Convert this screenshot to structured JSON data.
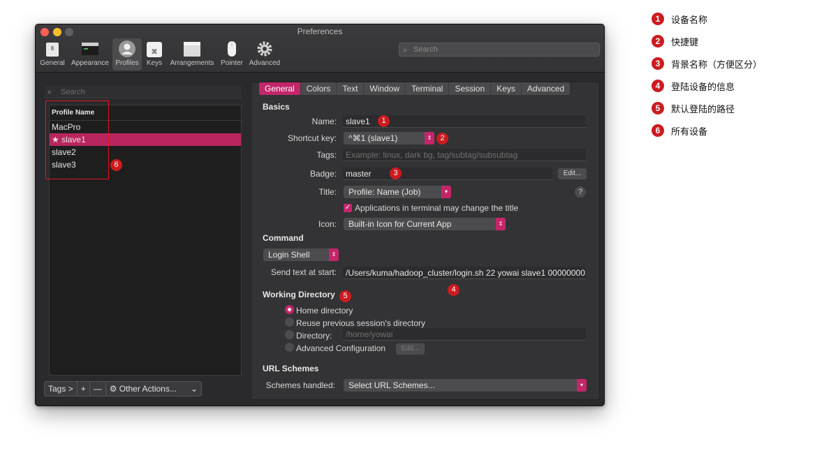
{
  "window": {
    "title": "Preferences",
    "search_placeholder": "Search"
  },
  "toolbar": {
    "items": [
      {
        "label": "General",
        "icon": "general-icon"
      },
      {
        "label": "Appearance",
        "icon": "appearance-icon"
      },
      {
        "label": "Profiles",
        "icon": "profiles-icon",
        "active": true
      },
      {
        "label": "Keys",
        "icon": "keys-icon"
      },
      {
        "label": "Arrangements",
        "icon": "arrangements-icon"
      },
      {
        "label": "Pointer",
        "icon": "pointer-icon"
      },
      {
        "label": "Advanced",
        "icon": "gear-icon"
      }
    ]
  },
  "profiles": {
    "search_placeholder": "Search",
    "header": "Profile Name",
    "rows": [
      "MacPro",
      "★ slave1",
      "slave2",
      "slave3"
    ],
    "selected_index": 1,
    "bottom": {
      "tags": "Tags >",
      "add": "+",
      "remove": "—",
      "other": "⚙ Other Actions...",
      "chevron": "⌄"
    }
  },
  "tabs": [
    "General",
    "Colors",
    "Text",
    "Window",
    "Terminal",
    "Session",
    "Keys",
    "Advanced"
  ],
  "general": {
    "basics_title": "Basics",
    "name_label": "Name:",
    "name_value": "slave1",
    "shortcut_label": "Shortcut key:",
    "shortcut_value": "^⌘1 (slave1)",
    "tags_label": "Tags:",
    "tags_placeholder": "Example: linux, dark bg, tag/subtag/subsubtag",
    "badge_label": "Badge:",
    "badge_value": "master",
    "badge_edit": "Edit...",
    "title_label": "Title:",
    "title_value": "Profile: Name (Job)",
    "help": "?",
    "title_checkbox_label": "Applications in terminal may change the title",
    "icon_label": "Icon:",
    "icon_value": "Built-in Icon for Current App",
    "command_title": "Command",
    "command_value": "Login Shell",
    "send_text_label": "Send text at start:",
    "send_text_value": "/Users/kuma/hadoop_cluster/login.sh 22 yowai slave1 00000000",
    "workdir_title": "Working Directory",
    "workdir_options": [
      "Home directory",
      "Reuse previous session's directory",
      "Directory:",
      "Advanced Configuration"
    ],
    "workdir_selected": 0,
    "directory_placeholder": "/home/yowai",
    "advanced_edit": "Edit...",
    "url_title": "URL Schemes",
    "schemes_label": "Schemes handled:",
    "schemes_value": "Select URL Schemes..."
  },
  "annotations": {
    "numbers": [
      "1",
      "2",
      "3",
      "4",
      "5",
      "6"
    ],
    "color": "#cc1b1f"
  },
  "legend": [
    {
      "num": "1",
      "text": "设备名称"
    },
    {
      "num": "2",
      "text": "快捷键"
    },
    {
      "num": "3",
      "text": "背景名称（方便区分）"
    },
    {
      "num": "4",
      "text": "登陆设备的信息"
    },
    {
      "num": "5",
      "text": "默认登陆的路径"
    },
    {
      "num": "6",
      "text": "所有设备"
    }
  ],
  "colors": {
    "accent": "#c4266a",
    "selection": "#b9265f",
    "window_bg": "#2a2a2c"
  }
}
